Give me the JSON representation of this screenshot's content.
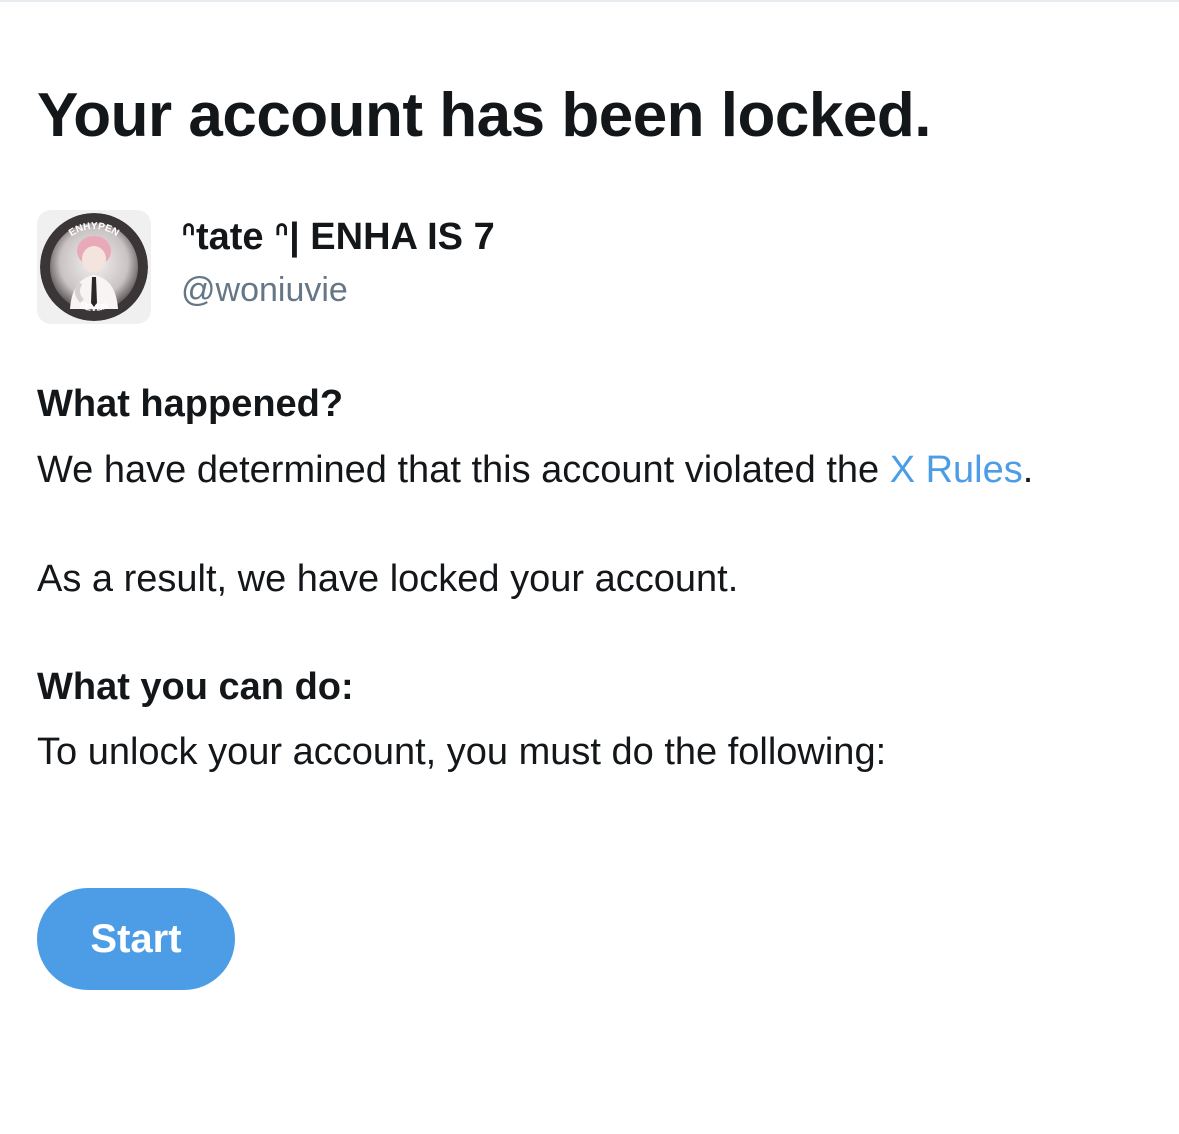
{
  "page": {
    "title": "Your account has been locked."
  },
  "account": {
    "display_name": "ᐢtate ᐢ| ENHA IS 7",
    "handle": "@woniuvie",
    "avatar_badge_top": "ENHYPEN",
    "avatar_badge_bottom": "SEVEN"
  },
  "what_happened": {
    "heading": "What happened?",
    "text_before_link": "We have determined that this account violated the ",
    "link_label": "X Rules",
    "text_after_link": ".",
    "result_text": "As a result, we have locked your account."
  },
  "what_you_can_do": {
    "heading": "What you can do:",
    "text": "To unlock your account, you must do the following:"
  },
  "actions": {
    "start_label": "Start"
  },
  "colors": {
    "link": "#4d9de6",
    "button": "#4d9de6",
    "handle": "#657786",
    "text": "#14171a"
  }
}
